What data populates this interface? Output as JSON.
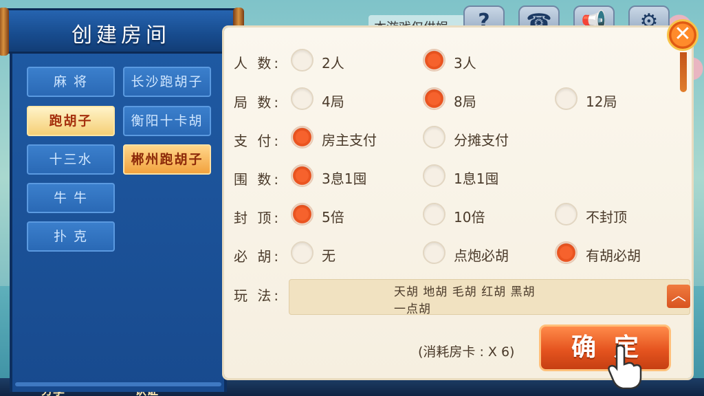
{
  "top": {
    "notice_text": "本游戏仅供娱",
    "icons": [
      "help-icon",
      "phone-icon",
      "megaphone-icon",
      "settings-icon"
    ]
  },
  "bottom_bar": {
    "left_text": "分享",
    "mid_text": "认证"
  },
  "left_panel": {
    "title": "创建房间",
    "games_left": [
      "麻 将",
      "跑胡子",
      "十三水",
      "牛 牛",
      "扑 克"
    ],
    "games_right": [
      "长沙跑胡子",
      "衡阳十卡胡",
      "郴州跑胡子"
    ],
    "selected_left": "跑胡子",
    "selected_right": "郴州跑胡子"
  },
  "settings": {
    "players": {
      "label": "人  数:",
      "options": [
        "2人",
        "3人"
      ],
      "selected": "3人"
    },
    "rounds": {
      "label": "局  数:",
      "options": [
        "4局",
        "8局",
        "12局"
      ],
      "selected": "8局"
    },
    "payment": {
      "label": "支  付:",
      "options": [
        "房主支付",
        "分摊支付"
      ],
      "selected": "房主支付"
    },
    "enclosure": {
      "label": "围  数:",
      "options": [
        "3息1囤",
        "1息1囤"
      ],
      "selected": "3息1囤"
    },
    "cap": {
      "label": "封  顶:",
      "options": [
        "5倍",
        "10倍",
        "不封顶"
      ],
      "selected": "5倍"
    },
    "must_hu": {
      "label": "必  胡:",
      "options": [
        "无",
        "点炮必胡",
        "有胡必胡"
      ],
      "selected": "有胡必胡"
    },
    "rules": {
      "label": "玩  法:",
      "line1": "天胡  地胡  毛胡  红胡  黑胡",
      "line2": "一点胡"
    }
  },
  "footer": {
    "cost_text": "(消耗房卡 : X 6)",
    "confirm_label": "确定"
  },
  "colors": {
    "panel_blue": "#1f5aa3",
    "accent_orange": "#e5541f",
    "paper": "#fbf7ee"
  }
}
